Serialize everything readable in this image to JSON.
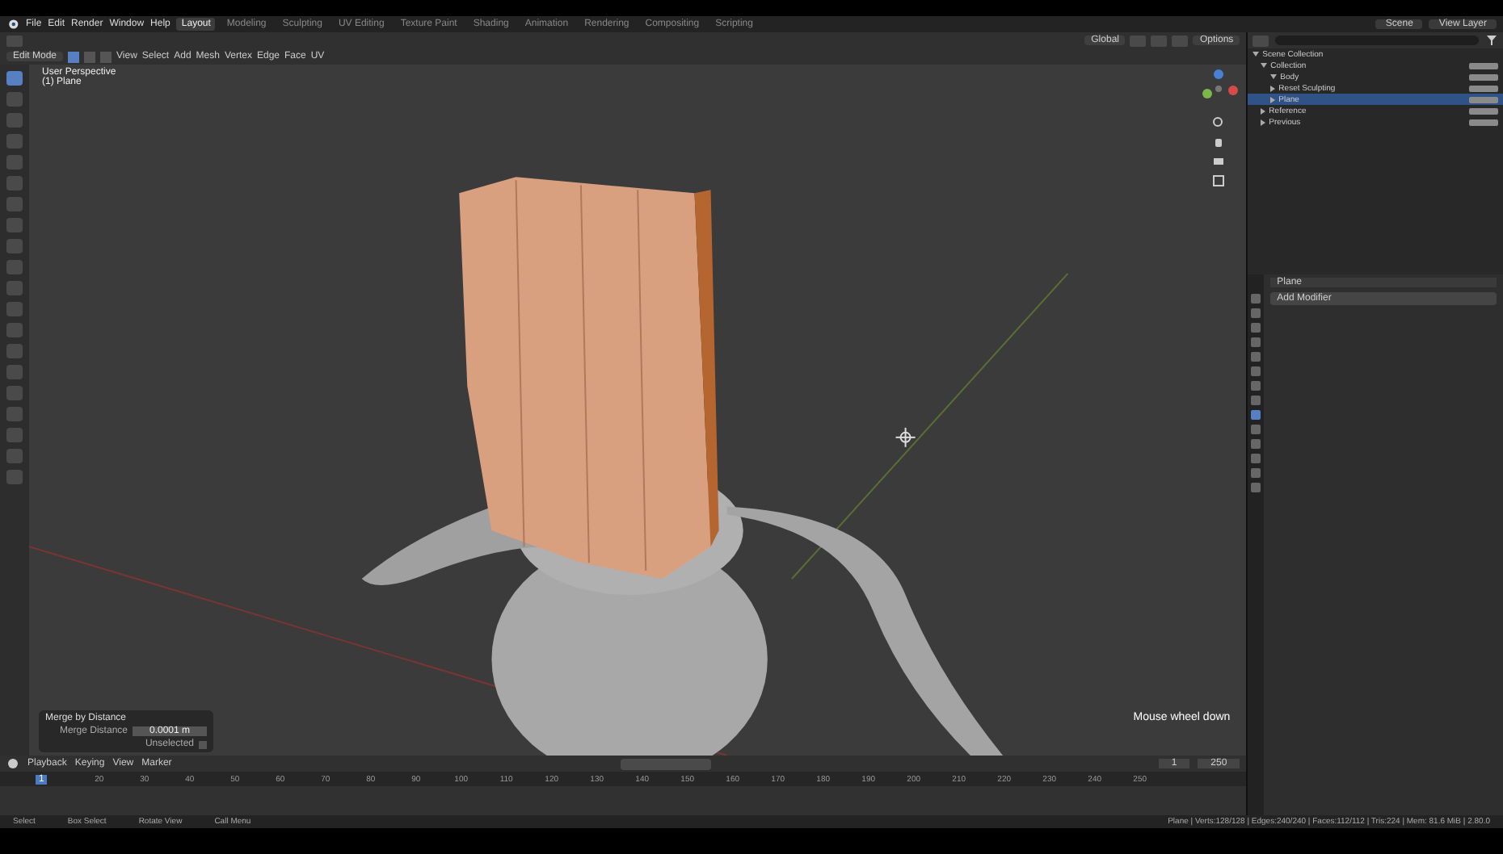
{
  "menu": [
    "File",
    "Edit",
    "Render",
    "Window",
    "Help"
  ],
  "workspaces": [
    {
      "label": "Layout",
      "selected": true
    },
    {
      "label": "Modeling",
      "selected": false
    },
    {
      "label": "Sculpting",
      "selected": false
    },
    {
      "label": "UV Editing",
      "selected": false
    },
    {
      "label": "Texture Paint",
      "selected": false
    },
    {
      "label": "Shading",
      "selected": false
    },
    {
      "label": "Animation",
      "selected": false
    },
    {
      "label": "Rendering",
      "selected": false
    },
    {
      "label": "Compositing",
      "selected": false
    },
    {
      "label": "Scripting",
      "selected": false
    }
  ],
  "scene": "Scene",
  "view_layer": "View Layer",
  "viewport": {
    "mode": "Edit Mode",
    "menus": [
      "View",
      "Select",
      "Add",
      "Mesh",
      "Vertex",
      "Edge",
      "Face",
      "UV"
    ],
    "select_modes": [
      {
        "selected": true
      },
      {
        "selected": false
      },
      {
        "selected": false
      }
    ],
    "orientation": "Global",
    "options": "Options",
    "view_name": "User Perspective",
    "object_name": "(1) Plane",
    "overlay_text": "Mouse wheel down"
  },
  "tools": [
    {
      "selected": true
    },
    {
      "selected": false
    },
    {
      "selected": false
    },
    {
      "selected": false
    },
    {
      "selected": false
    },
    {
      "selected": false
    },
    {
      "selected": false
    },
    {
      "selected": false
    },
    {
      "selected": false
    },
    {
      "selected": false
    },
    {
      "selected": false
    },
    {
      "selected": false
    },
    {
      "selected": false
    },
    {
      "selected": false
    },
    {
      "selected": false
    },
    {
      "selected": false
    },
    {
      "selected": false
    },
    {
      "selected": false
    },
    {
      "selected": false
    },
    {
      "selected": false
    }
  ],
  "operator_panel": {
    "title": "Merge by Distance",
    "field_label": "Merge Distance",
    "field_value": "0.0001 m",
    "checkbox_label": "Unselected",
    "checked": false
  },
  "outliner": {
    "tree": [
      {
        "label": "Scene Collection",
        "selected": false,
        "expanded": true,
        "children": [
          {
            "label": "Collection",
            "selected": false,
            "expanded": true,
            "children": [
              {
                "label": "Body",
                "selected": false,
                "expanded": true
              },
              {
                "label": "Reset Sculpting",
                "selected": false,
                "expanded": false
              },
              {
                "label": "Plane",
                "selected": true,
                "expanded": false
              }
            ]
          },
          {
            "label": "Reference",
            "selected": false,
            "expanded": false
          },
          {
            "label": "Previous",
            "selected": false,
            "expanded": false
          }
        ]
      }
    ]
  },
  "properties": {
    "object": "Plane",
    "add_modifier": "Add Modifier",
    "tabs": [
      {
        "selected": false
      },
      {
        "selected": false
      },
      {
        "selected": false
      },
      {
        "selected": false
      },
      {
        "selected": false
      },
      {
        "selected": false
      },
      {
        "selected": false
      },
      {
        "selected": false
      },
      {
        "selected": true
      },
      {
        "selected": false
      },
      {
        "selected": false
      },
      {
        "selected": false
      },
      {
        "selected": false
      },
      {
        "selected": false
      }
    ]
  },
  "timeline": {
    "menus": [
      "Playback",
      "Keying",
      "View",
      "Marker"
    ],
    "current_frame": "1",
    "start_frame": "1",
    "end_frame": "250",
    "ticks": [
      "20",
      "30",
      "40",
      "50",
      "60",
      "70",
      "80",
      "90",
      "100",
      "110",
      "120",
      "130",
      "140",
      "150",
      "160",
      "170",
      "180",
      "190",
      "200",
      "210",
      "220",
      "230",
      "240",
      "250"
    ]
  },
  "status_bar": {
    "hints": [
      "Select",
      "Box Select",
      "Rotate View",
      "Call Menu"
    ],
    "stats": "Plane | Verts:128/128 | Edges:240/240 | Faces:112/112 | Tris:224 | Mem: 81.6 MiB | 2.80.0"
  }
}
